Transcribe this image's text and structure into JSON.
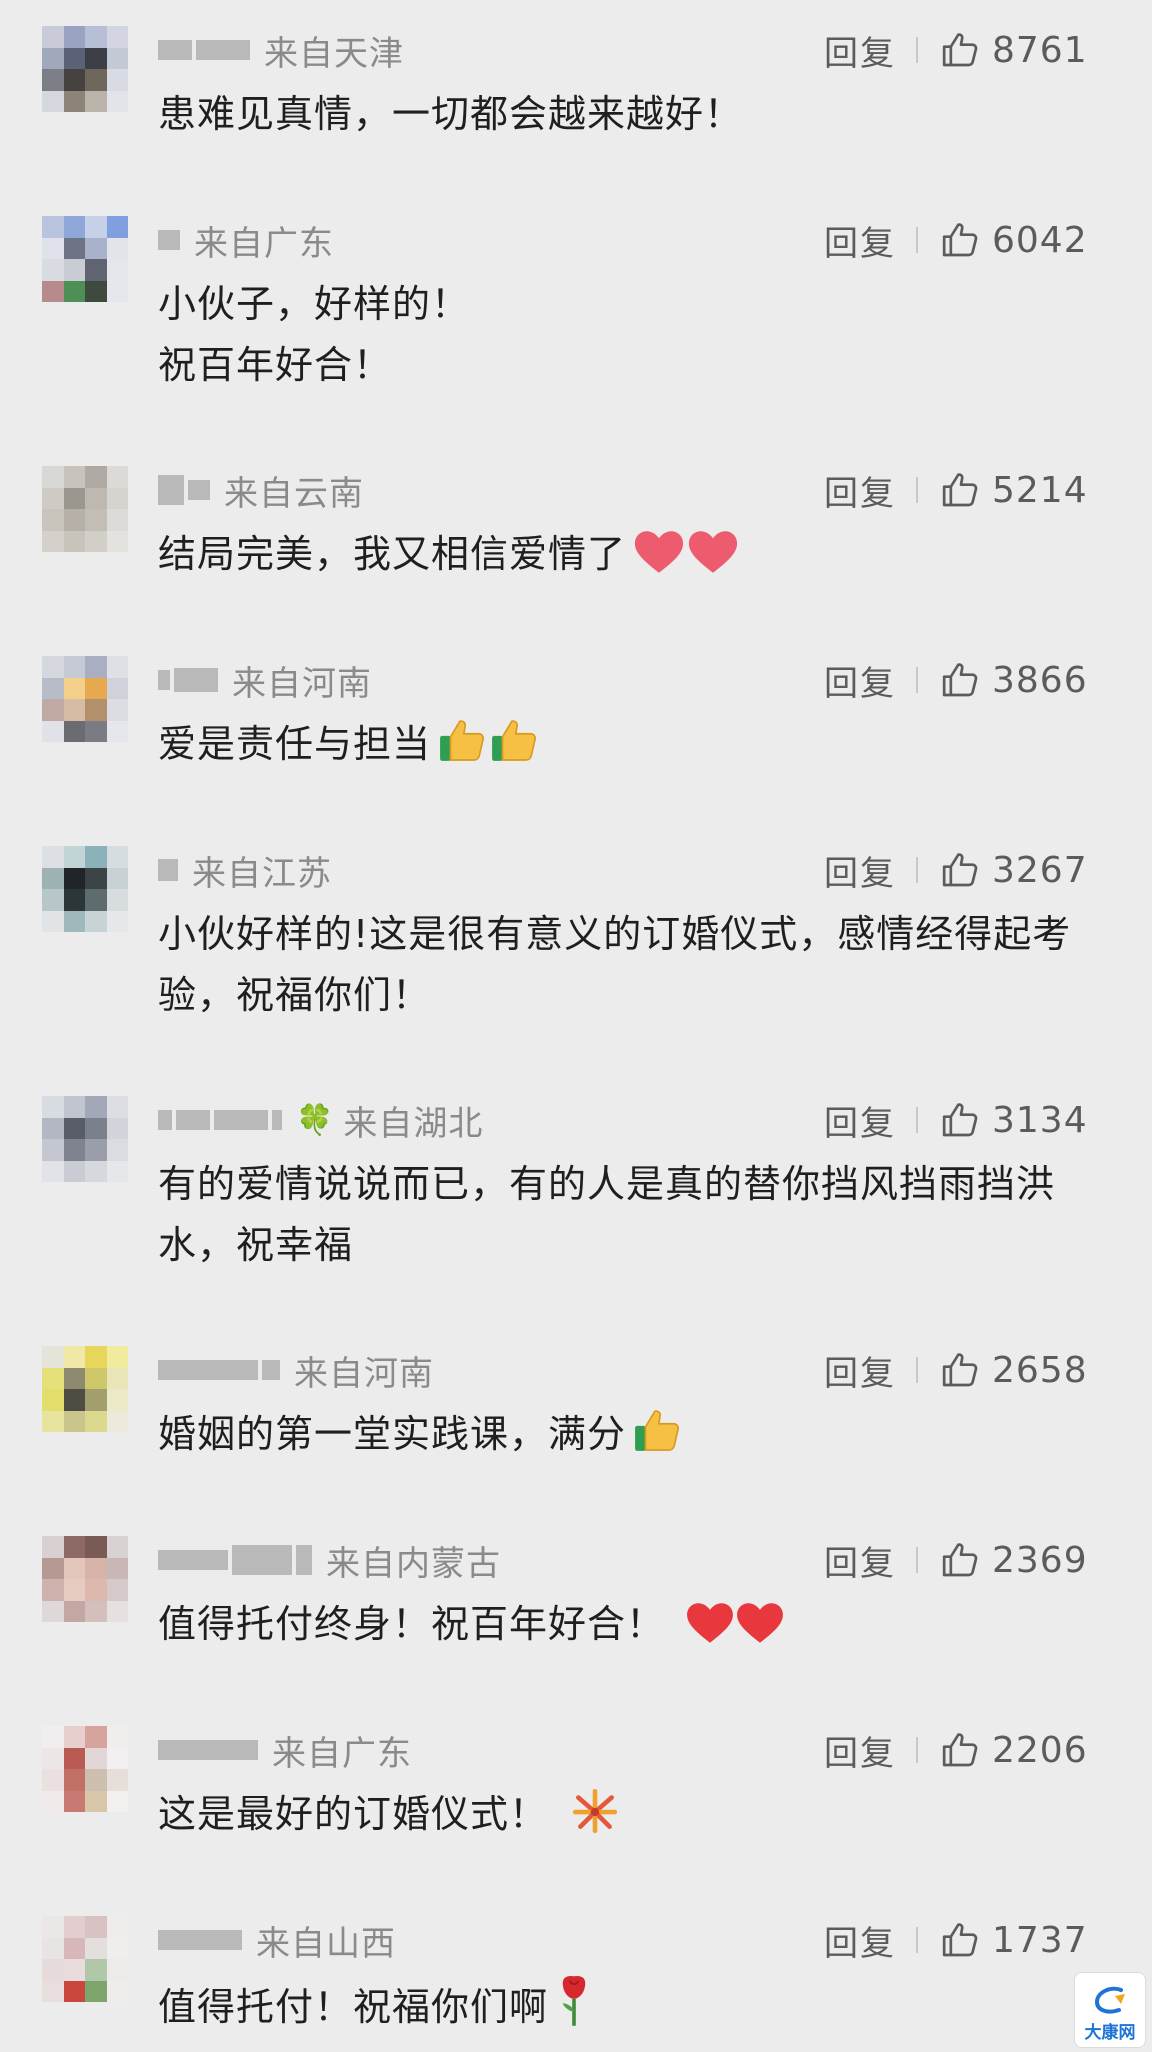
{
  "reply_label": "回复",
  "comments": [
    {
      "region": "来自天津",
      "text": "患难见真情，一切都会越来越好！",
      "likes": "8761"
    },
    {
      "region": "来自广东",
      "text": "小伙子，好样的！\n祝百年好合！",
      "likes": "6042"
    },
    {
      "region": "来自云南",
      "text": "结局完美，我又相信爱情了",
      "likes": "5214",
      "emoji": "red-heart-icon ×2"
    },
    {
      "region": "来自河南",
      "text": "爱是责任与担当",
      "likes": "3866",
      "emoji": "thumbs-up-icon ×2"
    },
    {
      "region": "来自江苏",
      "text": "小伙好样的!这是很有意义的订婚仪式，感情经得起考验，祝福你们！",
      "likes": "3267"
    },
    {
      "region": "来自湖北",
      "text": "有的爱情说说而已，有的人是真的替你挡风挡雨挡洪水，祝幸福",
      "likes": "3134",
      "name_badge": "clover-icon"
    },
    {
      "region": "来自河南",
      "text": "婚姻的第一堂实践课，满分",
      "likes": "2658",
      "emoji": "thumbs-up-icon"
    },
    {
      "region": "来自内蒙古",
      "text": "值得托付终身！祝百年好合！",
      "likes": "2369",
      "emoji": "red-heart-icon ×2"
    },
    {
      "region": "来自广东",
      "text": "这是最好的订婚仪式！",
      "likes": "2206",
      "emoji": "fireworks-icon"
    },
    {
      "region": "来自山西",
      "text": "值得托付！祝福你们啊",
      "likes": "1737",
      "emoji": "rose-icon"
    }
  ],
  "watermark": {
    "label": "大康网"
  },
  "colors": {
    "background": "#ececec",
    "muted_text": "#8a8a8a",
    "action_text": "#5b5b5b",
    "body_text": "#1f1f1f"
  }
}
